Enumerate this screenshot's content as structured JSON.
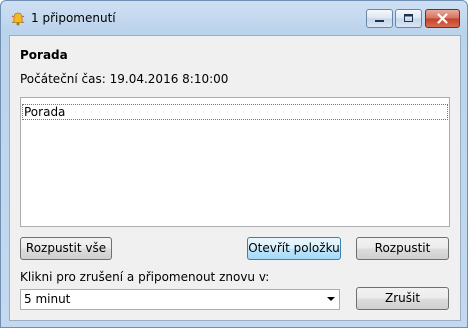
{
  "window": {
    "title": "1 připomenutí",
    "icon": "bell-icon"
  },
  "reminder": {
    "subject": "Porada",
    "start_label": "Počáteční čas:",
    "start_value": "19.04.2016 8:10:00"
  },
  "list": {
    "items": [
      {
        "label": "Porada"
      }
    ]
  },
  "buttons": {
    "dismiss_all": "Rozpustit vše",
    "open_item": "Otevřít položku",
    "dismiss": "Rozpustit",
    "snooze": "Zrušit"
  },
  "snooze": {
    "label": "Klikni pro zrušení a připomenout znovu v:",
    "selected": "5 minut"
  },
  "colors": {
    "close_button": "#c5412b",
    "titlebar": "#c4d9f0",
    "default_button": "#a7d9f5"
  }
}
